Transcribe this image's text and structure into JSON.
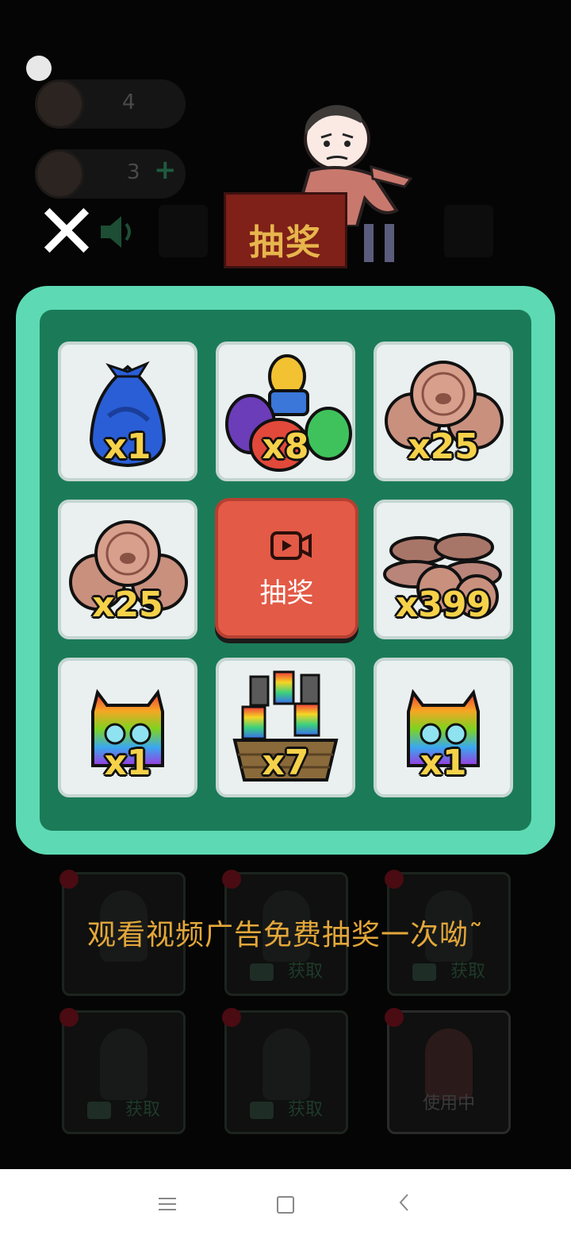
{
  "header": {
    "coin_count": "4",
    "tickets_count": "3",
    "banner_label": "抽奖"
  },
  "modal": {
    "draw_button_label": "抽奖",
    "prizes": [
      {
        "item": "blue-trash-bag",
        "qty": "x1"
      },
      {
        "item": "colored-trash-bags",
        "qty": "x8"
      },
      {
        "item": "pig-coins",
        "qty": "x25"
      },
      {
        "item": "pig-coins",
        "qty": "x25"
      },
      {
        "item": "coin-stack",
        "qty": "x399"
      },
      {
        "item": "rainbow-cat-box",
        "qty": "x1"
      },
      {
        "item": "rainbow-basket",
        "qty": "x7"
      },
      {
        "item": "rainbow-cat-box",
        "qty": "x1"
      }
    ]
  },
  "hint_text": "观看视频广告免费抽奖一次呦˜",
  "character_cards": [
    {
      "action": ""
    },
    {
      "action": "获取"
    },
    {
      "action": "获取"
    },
    {
      "action": "获取"
    },
    {
      "action": "获取"
    },
    {
      "action": "使用中"
    }
  ],
  "colors": {
    "modal_border": "#5ddab3",
    "modal_bg": "#1b7b58",
    "draw_button": "#e35a46",
    "qty_text": "#f6d24a",
    "hint_text": "#e3a73a"
  }
}
